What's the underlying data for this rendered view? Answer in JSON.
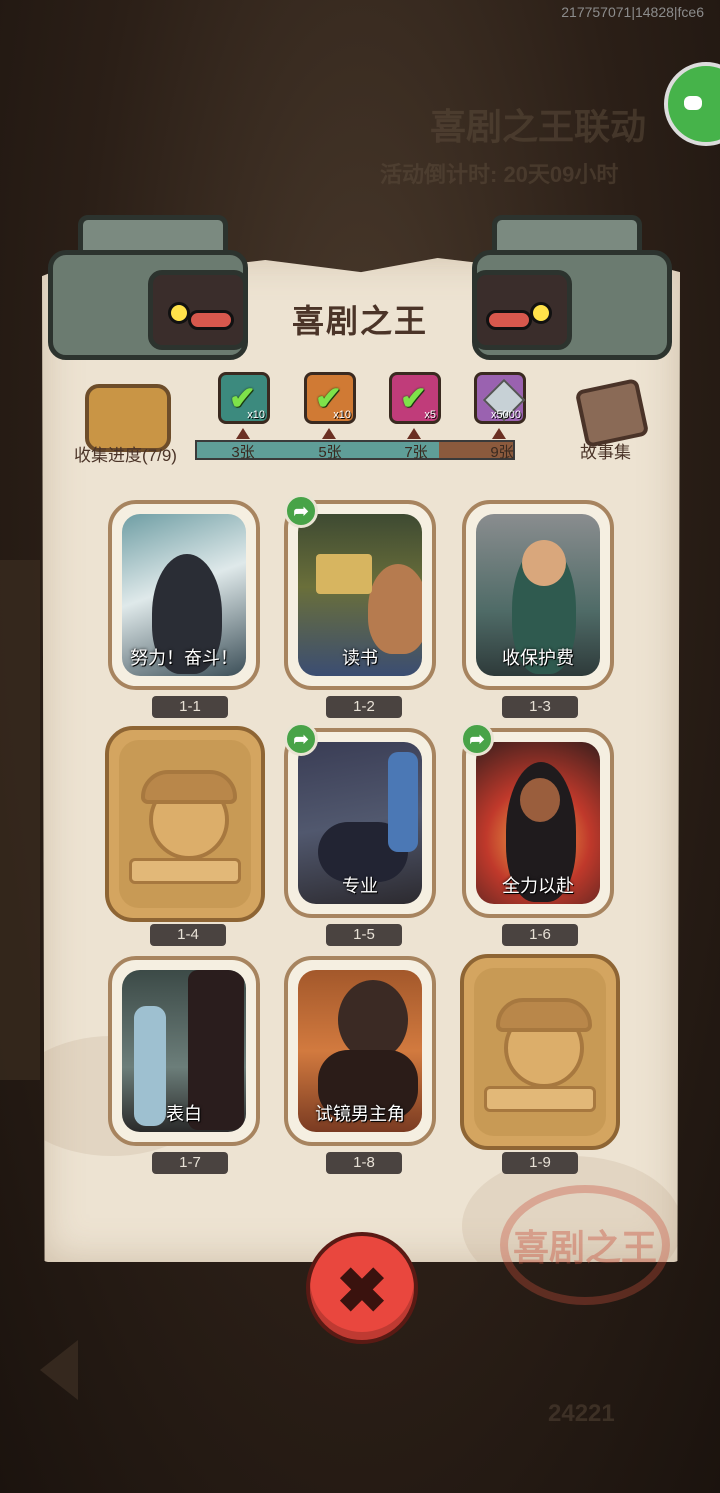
{
  "device_id": "217757071|14828|fce6",
  "background": {
    "event_title": "喜剧之王联动",
    "countdown": "活动倒计时: 20天09小时",
    "bottom_number": "24221"
  },
  "colors": {
    "accent_red": "#e9473e",
    "progress_teal": "#5f9e98",
    "paper": "#ede3d2",
    "share_green": "#48a348"
  },
  "panel": {
    "title": "喜剧之王",
    "collection_label": "收集进度(7/9)",
    "story_label": "故事集",
    "seal_text": "喜剧之王",
    "progress": {
      "collected": 7,
      "total": 9
    },
    "milestones": [
      {
        "label": "3张",
        "reward_qty": "x10",
        "claimed": true,
        "icon": "green-chest-icon"
      },
      {
        "label": "5张",
        "reward_qty": "x10",
        "claimed": true,
        "icon": "orange-chest-icon"
      },
      {
        "label": "7张",
        "reward_qty": "x5",
        "claimed": true,
        "icon": "orb-icon"
      },
      {
        "label": "9张",
        "reward_qty": "x5000",
        "claimed": false,
        "icon": "gem-icon"
      }
    ],
    "cards": [
      {
        "id": "1-1",
        "name": "努力！奋斗！",
        "unlocked": true,
        "shareable": false
      },
      {
        "id": "1-2",
        "name": "读书",
        "unlocked": true,
        "shareable": true
      },
      {
        "id": "1-3",
        "name": "收保护费",
        "unlocked": true,
        "shareable": false
      },
      {
        "id": "1-4",
        "name": "",
        "unlocked": false,
        "shareable": false
      },
      {
        "id": "1-5",
        "name": "专业",
        "unlocked": true,
        "shareable": true
      },
      {
        "id": "1-6",
        "name": "全力以赴",
        "unlocked": true,
        "shareable": true
      },
      {
        "id": "1-7",
        "name": "表白",
        "unlocked": true,
        "shareable": false
      },
      {
        "id": "1-8",
        "name": "试镜男主角",
        "unlocked": true,
        "shareable": false
      },
      {
        "id": "1-9",
        "name": "",
        "unlocked": false,
        "shareable": false
      }
    ]
  },
  "close_button": {
    "icon": "close-icon",
    "glyph": "✖"
  }
}
